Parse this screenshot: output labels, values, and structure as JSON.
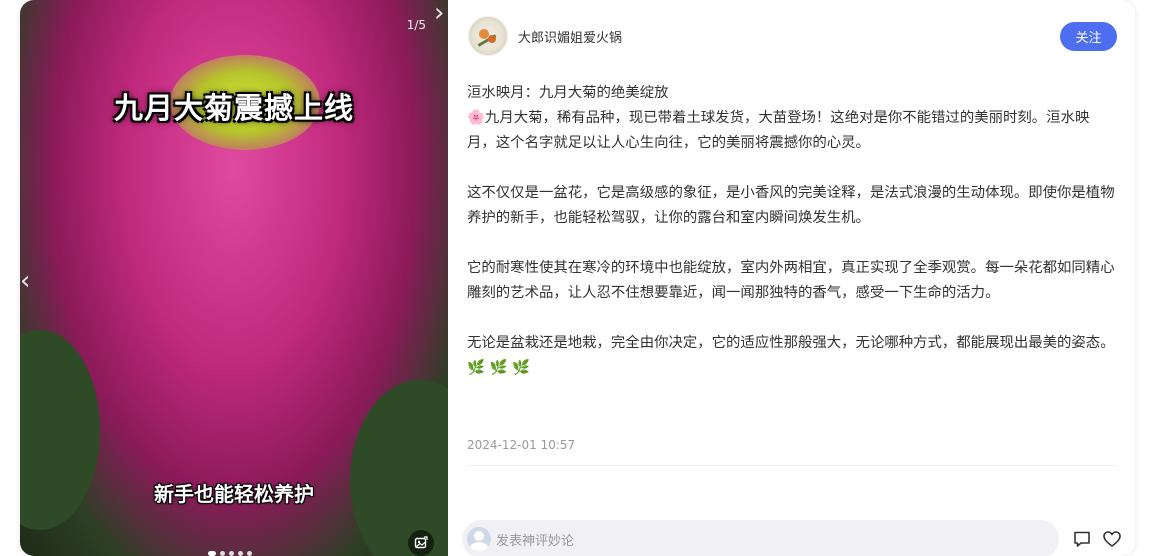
{
  "media": {
    "counter": "1/5",
    "overlay_top": "九月大菊震撼上线",
    "overlay_bottom": "新手也能轻松养护",
    "prev_arrow": "‹",
    "next_arrow": "›",
    "icons": [
      "chevron-left-icon",
      "chevron-right-icon",
      "image-expand-icon"
    ]
  },
  "post": {
    "author": "大郎识媚姐爱火锅",
    "follow_label": "关注",
    "title": "洹水映月：九月大菊的绝美绽放",
    "para1_emoji": "🌸",
    "para1": "九月大菊，稀有品种，现已带着土球发货，大苗登场！这绝对是你不能错过的美丽时刻。洹水映月，这个名字就足以让人心生向往，它的美丽将震撼你的心灵。",
    "para2": "这不仅仅是一盆花，它是高级感的象征，是小香风的完美诠释，是法式浪漫的生动体现。即使你是植物养护的新手，也能轻松驾驭，让你的露台和室内瞬间焕发生机。",
    "para3": "它的耐寒性使其在寒冷的环境中也能绽放，室内外两相宜，真正实现了全季观赏。每一朵花都如同精心雕刻的艺术品，让人忍不住想要靠近，闻一闻那独特的香气，感受一下生命的活力。",
    "para4": "无论是盆栽还是地栽，完全由你决定，它的适应性那般强大，无论哪种方式，都能展现出最美的姿态。",
    "para4_emoji": "🌿 🌿 🌿",
    "date": "2024-12-01 10:57"
  },
  "comment": {
    "placeholder": "发表神评妙论"
  },
  "icons": {
    "comment": "comment-bubble-icon",
    "like": "heart-icon"
  }
}
